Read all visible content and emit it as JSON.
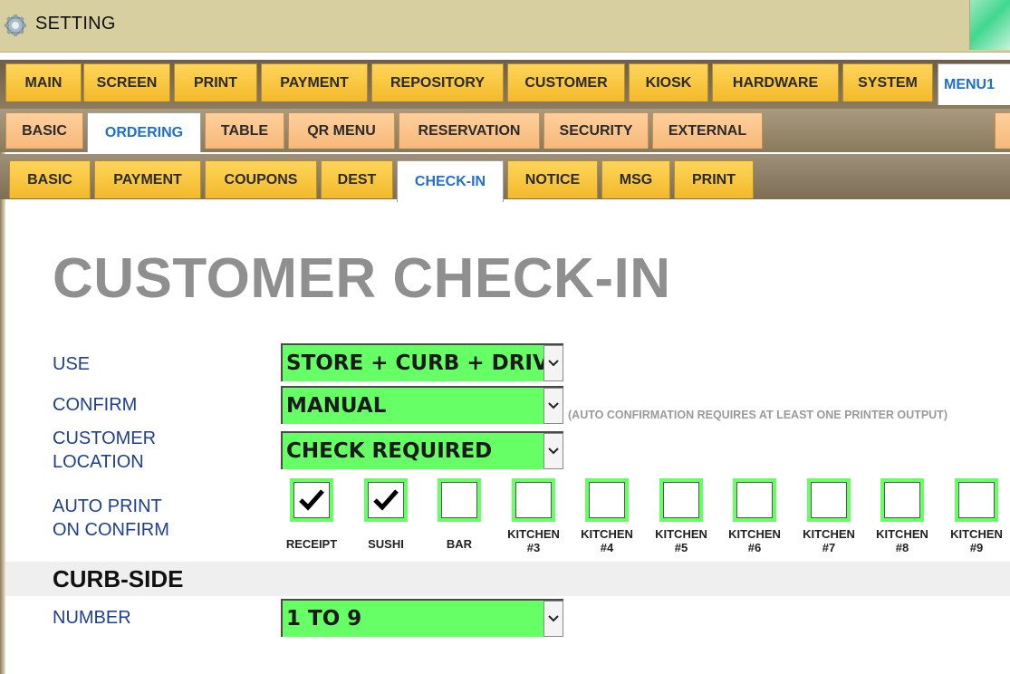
{
  "window": {
    "title": "SETTING",
    "icon": "gear-icon"
  },
  "tabs_main": [
    "MAIN",
    "SCREEN",
    "PRINT",
    "PAYMENT",
    "REPOSITORY",
    "CUSTOMER",
    "KIOSK",
    "HARDWARE",
    "SYSTEM",
    "MENU1"
  ],
  "tabs_main_active": "MENU1",
  "tabs_sub": [
    "BASIC",
    "ORDERING",
    "TABLE",
    "QR MENU",
    "RESERVATION",
    "SECURITY",
    "EXTERNAL"
  ],
  "tabs_sub_active": "ORDERING",
  "tabs_sub2": [
    "BASIC",
    "PAYMENT",
    "COUPONS",
    "DEST",
    "CHECK-IN",
    "NOTICE",
    "MSG",
    "PRINT"
  ],
  "tabs_sub2_active": "CHECK-IN",
  "page": {
    "heading": "CUSTOMER CHECK-IN"
  },
  "fields": {
    "use": {
      "label": "USE",
      "value": "STORE + CURB + DRIVE"
    },
    "confirm": {
      "label": "CONFIRM",
      "value": "MANUAL",
      "note": "(AUTO CONFIRMATION REQUIRES AT LEAST ONE PRINTER OUTPUT)"
    },
    "location": {
      "label_line1": "CUSTOMER",
      "label_line2": "LOCATION",
      "value": "CHECK REQUIRED"
    },
    "auto_print": {
      "label_line1": "AUTO PRINT",
      "label_line2": "ON CONFIRM",
      "options": [
        {
          "line1": "RECEIPT",
          "line2": "",
          "checked": true
        },
        {
          "line1": "SUSHI",
          "line2": "",
          "checked": true
        },
        {
          "line1": "BAR",
          "line2": "",
          "checked": false
        },
        {
          "line1": "KITCHEN",
          "line2": "#3",
          "checked": false
        },
        {
          "line1": "KITCHEN",
          "line2": "#4",
          "checked": false
        },
        {
          "line1": "KITCHEN",
          "line2": "#5",
          "checked": false
        },
        {
          "line1": "KITCHEN",
          "line2": "#6",
          "checked": false
        },
        {
          "line1": "KITCHEN",
          "line2": "#7",
          "checked": false
        },
        {
          "line1": "KITCHEN",
          "line2": "#8",
          "checked": false
        },
        {
          "line1": "KITCHEN",
          "line2": "#9",
          "checked": false
        }
      ]
    }
  },
  "curbside": {
    "title": "CURB-SIDE",
    "number": {
      "label": "NUMBER",
      "value": "1 TO 9"
    }
  },
  "colors": {
    "accent_green": "#66ff66",
    "tab_gold": "#f3b92a",
    "tab_peach": "#f6b97a",
    "active_tab_text": "#1f6fd0"
  }
}
